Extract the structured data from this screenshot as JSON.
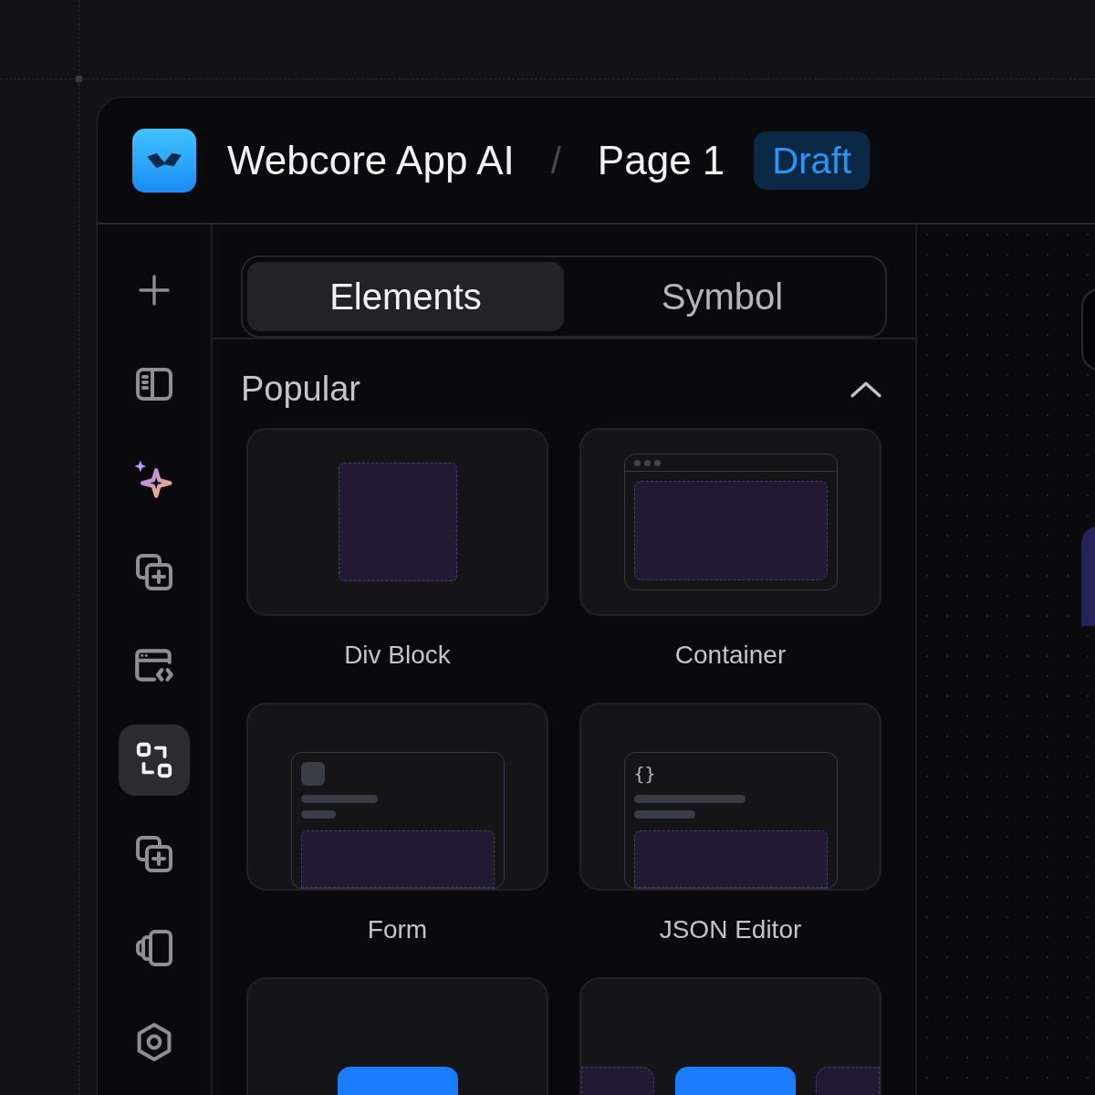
{
  "header": {
    "app_name": "Webcore App AI",
    "separator": "/",
    "page_name": "Page 1",
    "status_badge": "Draft"
  },
  "rail": [
    {
      "kind": "add",
      "selected": false
    },
    {
      "kind": "panel",
      "selected": false
    },
    {
      "kind": "ai",
      "selected": false
    },
    {
      "kind": "duplicate",
      "selected": false
    },
    {
      "kind": "code",
      "selected": false
    },
    {
      "kind": "components",
      "selected": true
    },
    {
      "kind": "duplicate",
      "selected": false
    },
    {
      "kind": "pages",
      "selected": false
    },
    {
      "kind": "settings",
      "selected": false
    }
  ],
  "tabs": [
    {
      "label": "Elements",
      "selected": true
    },
    {
      "label": "Symbol",
      "selected": false
    }
  ],
  "section": {
    "title": "Popular",
    "expanded": true
  },
  "elements": [
    {
      "kind": "div",
      "label": "Div Block"
    },
    {
      "kind": "container",
      "label": "Container"
    },
    {
      "kind": "form",
      "label": "Form"
    },
    {
      "kind": "json",
      "label": "JSON Editor",
      "glyph": "{}"
    },
    {
      "kind": "button"
    },
    {
      "kind": "button_group"
    }
  ]
}
